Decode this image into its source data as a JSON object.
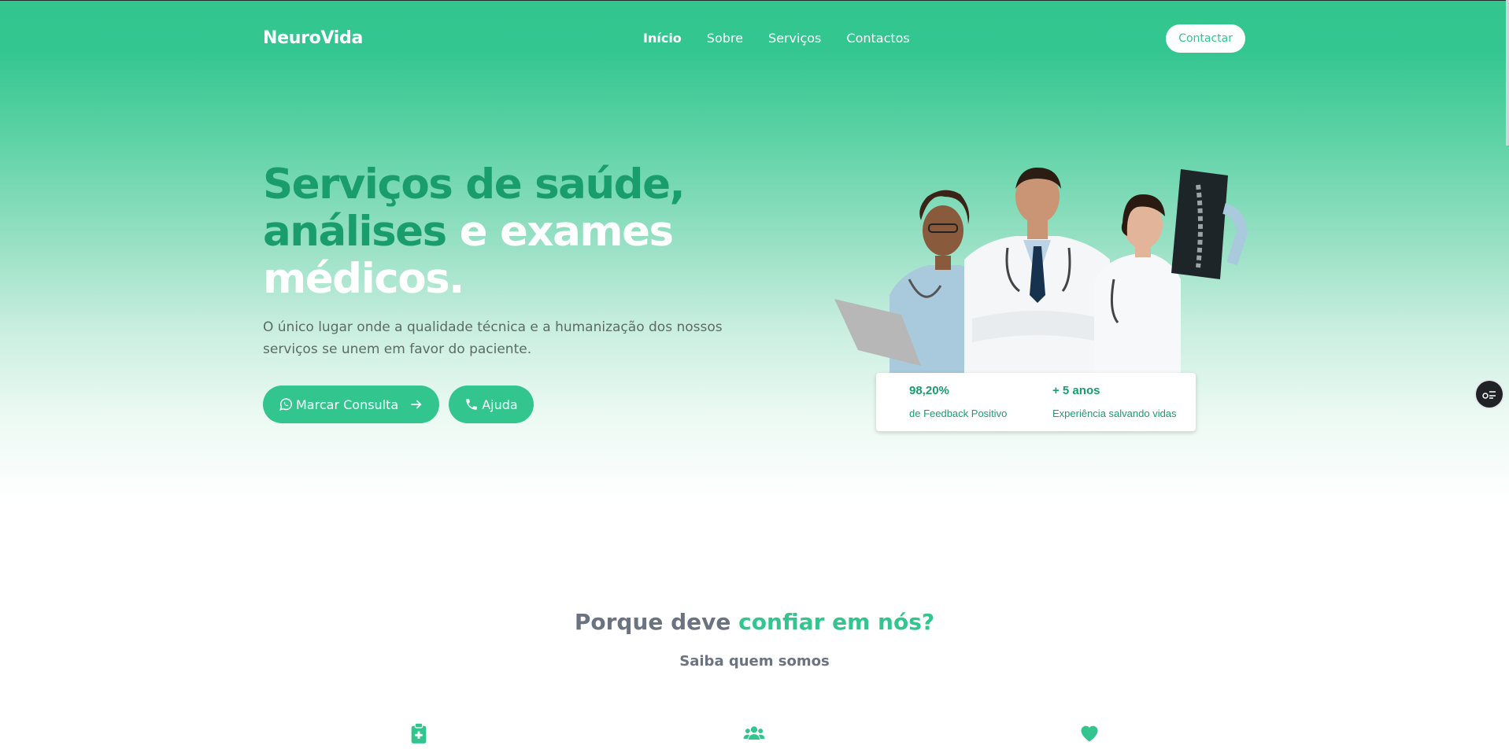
{
  "header": {
    "brand": "NeuroVida",
    "nav": [
      {
        "label": "Início"
      },
      {
        "label": "Sobre"
      },
      {
        "label": "Serviços"
      },
      {
        "label": "Contactos"
      }
    ],
    "contact_label": "Contactar"
  },
  "hero": {
    "title_part1": "Serviços de saúde, análises",
    "title_part2": " e exames médicos.",
    "subtitle": "O único lugar onde a qualidade técnica e a humanização dos nossos serviços se unem em favor do paciente.",
    "primary_button": "Marcar Consulta",
    "secondary_button": "Ajuda",
    "image_alt": "medical-team-photo"
  },
  "stats": [
    {
      "value": "98,20%",
      "label": "de Feedback Positivo"
    },
    {
      "value": "+ 5 anos",
      "label": "Experiência salvando vidas"
    }
  ],
  "trust": {
    "title_part1": "Porque deve ",
    "title_part2": "confiar em nós?",
    "subtitle": "Saiba quem somos",
    "icons": [
      "clipboard-medical-icon",
      "users-icon",
      "heart-icon"
    ]
  },
  "colors": {
    "primary": "#32c58e",
    "dark_green": "#1a9d6c",
    "text_gray": "#6b7280"
  }
}
